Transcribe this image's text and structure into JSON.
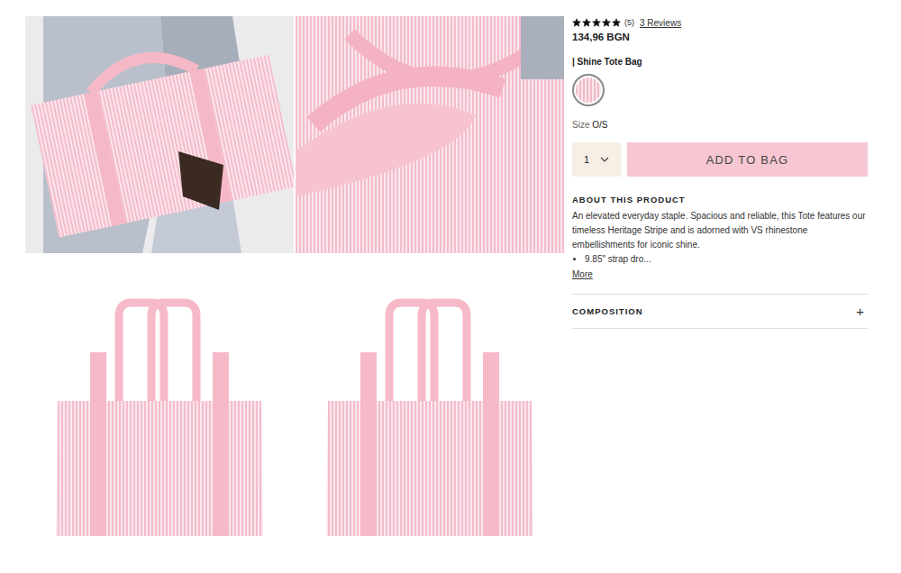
{
  "product": {
    "rating": {
      "stars": 5,
      "count": "(5)",
      "reviews": "3 Reviews"
    },
    "price": "134,96 BGN",
    "name": "| Shine Tote Bag",
    "swatches": [
      {
        "selected": true
      }
    ],
    "size": {
      "label": "Size",
      "value": "O/S"
    },
    "quantity": "1",
    "add_button": "ADD TO BAG",
    "about": {
      "heading": "ABOUT THIS PRODUCT",
      "description": "An elevated everyday staple. Spacious and reliable, this Tote features our timeless Heritage Stripe and is adorned with VS rhinestone embellishments for iconic shine.",
      "bullets": [
        "9.85\" strap dro..."
      ],
      "more": "More"
    },
    "accordions": [
      {
        "title": "COMPOSITION",
        "icon": "+",
        "expanded": false
      }
    ]
  }
}
